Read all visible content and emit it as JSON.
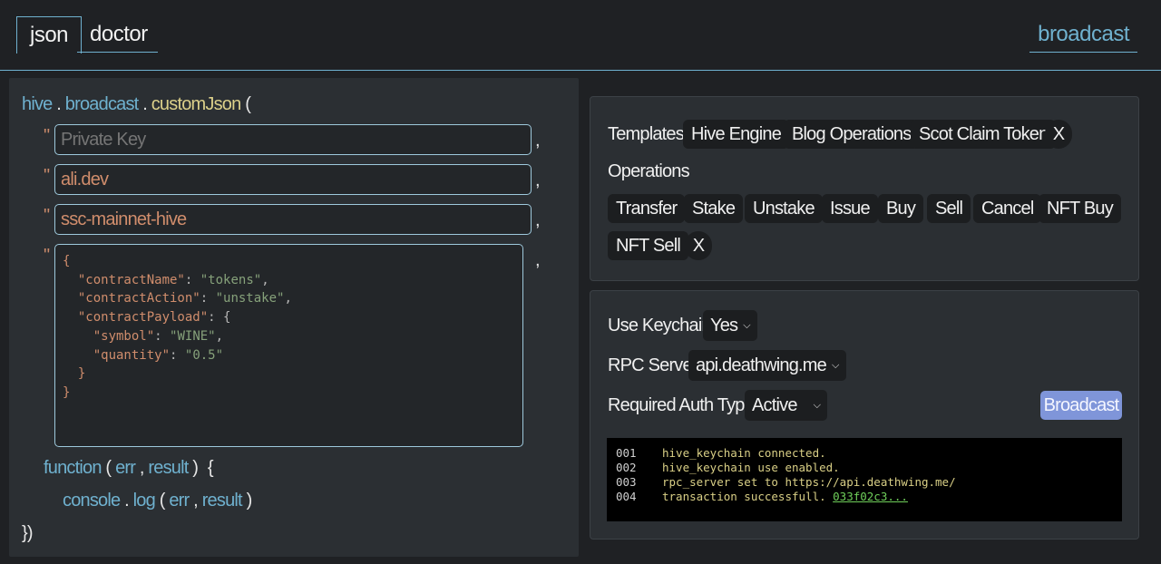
{
  "nav": {
    "tabs": [
      {
        "label": "json",
        "active": true
      },
      {
        "label": "doctor",
        "active": false
      }
    ],
    "broadcast_link": "broadcast"
  },
  "editor": {
    "call": {
      "object": "hive",
      "dot1": ".",
      "namespace": "broadcast",
      "dot2": ".",
      "method": "customJson",
      "open_paren": "("
    },
    "quote": "\"",
    "comma": ",",
    "params": {
      "private_key_placeholder": "Private Key",
      "private_key_value": "",
      "username": "ali.dev",
      "id": "ssc-mainnet-hive"
    },
    "json_lines": [
      "{",
      "  \"contractName\": \"tokens\",",
      "  \"contractAction\": \"unstake\",",
      "  \"contractPayload\": {",
      "    \"symbol\": \"WINE\",",
      "    \"quantity\": \"0.5\"",
      "  }",
      "}"
    ],
    "callback": {
      "keyword": "function",
      "open_paren": "(",
      "arg1": "err",
      "comma": ",",
      "arg2": "result",
      "close_paren": ")",
      "brace": "{"
    },
    "body": {
      "object": "console",
      "dot": ".",
      "method": "log",
      "open_paren": "(",
      "arg1": "err",
      "comma": ",",
      "arg2": "result",
      "close_paren": ")"
    },
    "closing": "})"
  },
  "templates": {
    "label": "Templates",
    "items": [
      "Hive Engine",
      "Blog Operations",
      "Scot Claim Token"
    ],
    "clear": "X"
  },
  "operations": {
    "label": "Operations",
    "items": [
      "Transfer",
      "Stake",
      "Unstake",
      "Issue",
      "Buy",
      "Sell",
      "Cancel",
      "NFT Buy",
      "NFT Sell"
    ],
    "clear": "X"
  },
  "settings": {
    "keychain_label": "Use Keychain",
    "keychain_value": "Yes",
    "rpc_label": "RPC Server",
    "rpc_value": "api.deathwing.me",
    "auth_label": "Required Auth Type",
    "auth_value": "Active",
    "broadcast_button": "Broadcast"
  },
  "console": [
    {
      "num": "001",
      "text": "hive_keychain connected.",
      "link": ""
    },
    {
      "num": "002",
      "text": "hive_keychain use enabled.",
      "link": ""
    },
    {
      "num": "003",
      "text": "rpc_server set to https://api.deathwing.me/",
      "link": ""
    },
    {
      "num": "004",
      "text": "transaction successfull. ",
      "link": "033f02c3..."
    }
  ],
  "colors": {
    "accent": "#6fb1cf",
    "broadcast_button": "#7f95d9",
    "console_text": "#d9cf86",
    "console_link": "#6fcf5a"
  }
}
